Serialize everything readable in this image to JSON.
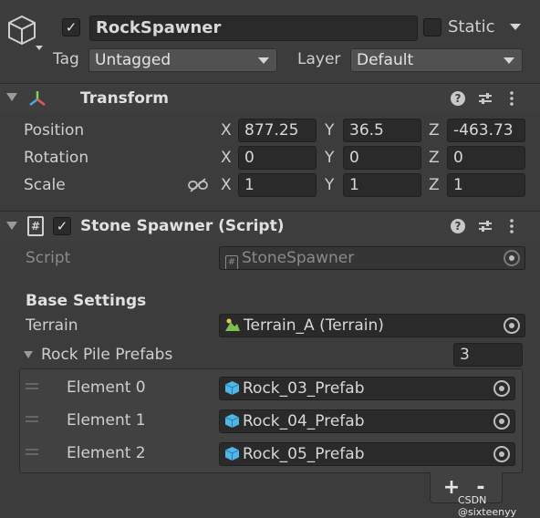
{
  "object": {
    "name": "RockSpawner",
    "active_checked": true,
    "static_label": "Static",
    "tag_label": "Tag",
    "tag_value": "Untagged",
    "layer_label": "Layer",
    "layer_value": "Default"
  },
  "transform": {
    "title": "Transform",
    "position": {
      "label": "Position",
      "x": "877.25",
      "y": "36.5",
      "z": "-463.73"
    },
    "rotation": {
      "label": "Rotation",
      "x": "0",
      "y": "0",
      "z": "0"
    },
    "scale": {
      "label": "Scale",
      "x": "1",
      "y": "1",
      "z": "1"
    },
    "axis_x": "X",
    "axis_y": "Y",
    "axis_z": "Z"
  },
  "script_component": {
    "title": "Stone Spawner (Script)",
    "script_label": "Script",
    "script_value": "StoneSpawner",
    "section_heading": "Base Settings",
    "terrain_label": "Terrain",
    "terrain_value": "Terrain_A (Terrain)",
    "list_label": "Rock Pile Prefabs",
    "list_count": "3",
    "elements": [
      {
        "label": "Element 0",
        "value": "Rock_03_Prefab"
      },
      {
        "label": "Element 1",
        "value": "Rock_04_Prefab"
      },
      {
        "label": "Element 2",
        "value": "Rock_05_Prefab"
      }
    ],
    "add_label": "+",
    "remove_label": "-"
  },
  "watermark": "CSDN @sixteenyy",
  "colors": {
    "background": "#3c3c3c",
    "field": "#2a2a2a",
    "accent_icon": "#4fb6e8"
  }
}
